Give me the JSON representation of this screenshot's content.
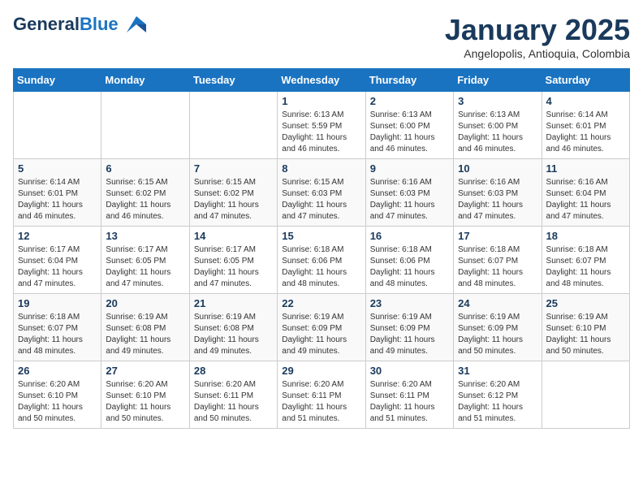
{
  "header": {
    "logo_line1": "General",
    "logo_line2": "Blue",
    "month": "January 2025",
    "location": "Angelopolis, Antioquia, Colombia"
  },
  "weekdays": [
    "Sunday",
    "Monday",
    "Tuesday",
    "Wednesday",
    "Thursday",
    "Friday",
    "Saturday"
  ],
  "weeks": [
    [
      {
        "day": "",
        "info": ""
      },
      {
        "day": "",
        "info": ""
      },
      {
        "day": "",
        "info": ""
      },
      {
        "day": "1",
        "info": "Sunrise: 6:13 AM\nSunset: 5:59 PM\nDaylight: 11 hours and 46 minutes."
      },
      {
        "day": "2",
        "info": "Sunrise: 6:13 AM\nSunset: 6:00 PM\nDaylight: 11 hours and 46 minutes."
      },
      {
        "day": "3",
        "info": "Sunrise: 6:13 AM\nSunset: 6:00 PM\nDaylight: 11 hours and 46 minutes."
      },
      {
        "day": "4",
        "info": "Sunrise: 6:14 AM\nSunset: 6:01 PM\nDaylight: 11 hours and 46 minutes."
      }
    ],
    [
      {
        "day": "5",
        "info": "Sunrise: 6:14 AM\nSunset: 6:01 PM\nDaylight: 11 hours and 46 minutes."
      },
      {
        "day": "6",
        "info": "Sunrise: 6:15 AM\nSunset: 6:02 PM\nDaylight: 11 hours and 46 minutes."
      },
      {
        "day": "7",
        "info": "Sunrise: 6:15 AM\nSunset: 6:02 PM\nDaylight: 11 hours and 47 minutes."
      },
      {
        "day": "8",
        "info": "Sunrise: 6:15 AM\nSunset: 6:03 PM\nDaylight: 11 hours and 47 minutes."
      },
      {
        "day": "9",
        "info": "Sunrise: 6:16 AM\nSunset: 6:03 PM\nDaylight: 11 hours and 47 minutes."
      },
      {
        "day": "10",
        "info": "Sunrise: 6:16 AM\nSunset: 6:03 PM\nDaylight: 11 hours and 47 minutes."
      },
      {
        "day": "11",
        "info": "Sunrise: 6:16 AM\nSunset: 6:04 PM\nDaylight: 11 hours and 47 minutes."
      }
    ],
    [
      {
        "day": "12",
        "info": "Sunrise: 6:17 AM\nSunset: 6:04 PM\nDaylight: 11 hours and 47 minutes."
      },
      {
        "day": "13",
        "info": "Sunrise: 6:17 AM\nSunset: 6:05 PM\nDaylight: 11 hours and 47 minutes."
      },
      {
        "day": "14",
        "info": "Sunrise: 6:17 AM\nSunset: 6:05 PM\nDaylight: 11 hours and 47 minutes."
      },
      {
        "day": "15",
        "info": "Sunrise: 6:18 AM\nSunset: 6:06 PM\nDaylight: 11 hours and 48 minutes."
      },
      {
        "day": "16",
        "info": "Sunrise: 6:18 AM\nSunset: 6:06 PM\nDaylight: 11 hours and 48 minutes."
      },
      {
        "day": "17",
        "info": "Sunrise: 6:18 AM\nSunset: 6:07 PM\nDaylight: 11 hours and 48 minutes."
      },
      {
        "day": "18",
        "info": "Sunrise: 6:18 AM\nSunset: 6:07 PM\nDaylight: 11 hours and 48 minutes."
      }
    ],
    [
      {
        "day": "19",
        "info": "Sunrise: 6:18 AM\nSunset: 6:07 PM\nDaylight: 11 hours and 48 minutes."
      },
      {
        "day": "20",
        "info": "Sunrise: 6:19 AM\nSunset: 6:08 PM\nDaylight: 11 hours and 49 minutes."
      },
      {
        "day": "21",
        "info": "Sunrise: 6:19 AM\nSunset: 6:08 PM\nDaylight: 11 hours and 49 minutes."
      },
      {
        "day": "22",
        "info": "Sunrise: 6:19 AM\nSunset: 6:09 PM\nDaylight: 11 hours and 49 minutes."
      },
      {
        "day": "23",
        "info": "Sunrise: 6:19 AM\nSunset: 6:09 PM\nDaylight: 11 hours and 49 minutes."
      },
      {
        "day": "24",
        "info": "Sunrise: 6:19 AM\nSunset: 6:09 PM\nDaylight: 11 hours and 50 minutes."
      },
      {
        "day": "25",
        "info": "Sunrise: 6:19 AM\nSunset: 6:10 PM\nDaylight: 11 hours and 50 minutes."
      }
    ],
    [
      {
        "day": "26",
        "info": "Sunrise: 6:20 AM\nSunset: 6:10 PM\nDaylight: 11 hours and 50 minutes."
      },
      {
        "day": "27",
        "info": "Sunrise: 6:20 AM\nSunset: 6:10 PM\nDaylight: 11 hours and 50 minutes."
      },
      {
        "day": "28",
        "info": "Sunrise: 6:20 AM\nSunset: 6:11 PM\nDaylight: 11 hours and 50 minutes."
      },
      {
        "day": "29",
        "info": "Sunrise: 6:20 AM\nSunset: 6:11 PM\nDaylight: 11 hours and 51 minutes."
      },
      {
        "day": "30",
        "info": "Sunrise: 6:20 AM\nSunset: 6:11 PM\nDaylight: 11 hours and 51 minutes."
      },
      {
        "day": "31",
        "info": "Sunrise: 6:20 AM\nSunset: 6:12 PM\nDaylight: 11 hours and 51 minutes."
      },
      {
        "day": "",
        "info": ""
      }
    ]
  ]
}
